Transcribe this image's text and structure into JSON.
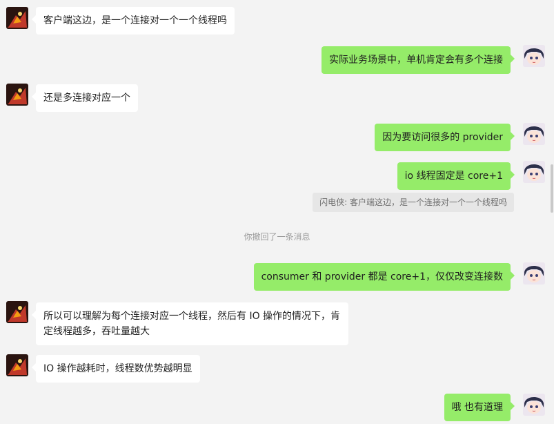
{
  "messages": [
    {
      "side": "left",
      "text": "客户端这边，是一个连接对一个一个线程吗"
    },
    {
      "side": "right",
      "text": "实际业务场景中，单机肯定会有多个连接"
    },
    {
      "side": "left",
      "text": "还是多连接对应一个"
    },
    {
      "side": "right",
      "text": "因为要访问很多的 provider"
    },
    {
      "side": "right",
      "text": "io 线程固定是 core+1"
    },
    {
      "side": "right",
      "text": "consumer 和 provider 都是 core+1，仅仅改变连接数"
    },
    {
      "side": "left",
      "text": "所以可以理解为每个连接对应一个线程，然后有 IO 操作的情况下，肯定线程越多，吞吐量越大"
    },
    {
      "side": "left",
      "text": "IO 操作越耗时，线程数优势越明显"
    },
    {
      "side": "right",
      "text": "哦 也有道理"
    }
  ],
  "quote": "闪电侠: 客户端这边，是一个连接对一个一个线程吗",
  "system_notice": "你撤回了一条消息",
  "colors": {
    "background": "#f3f3f3",
    "bubble_self": "#95ec69",
    "bubble_other": "#ffffff",
    "quote_bg": "#e6e6e6"
  }
}
